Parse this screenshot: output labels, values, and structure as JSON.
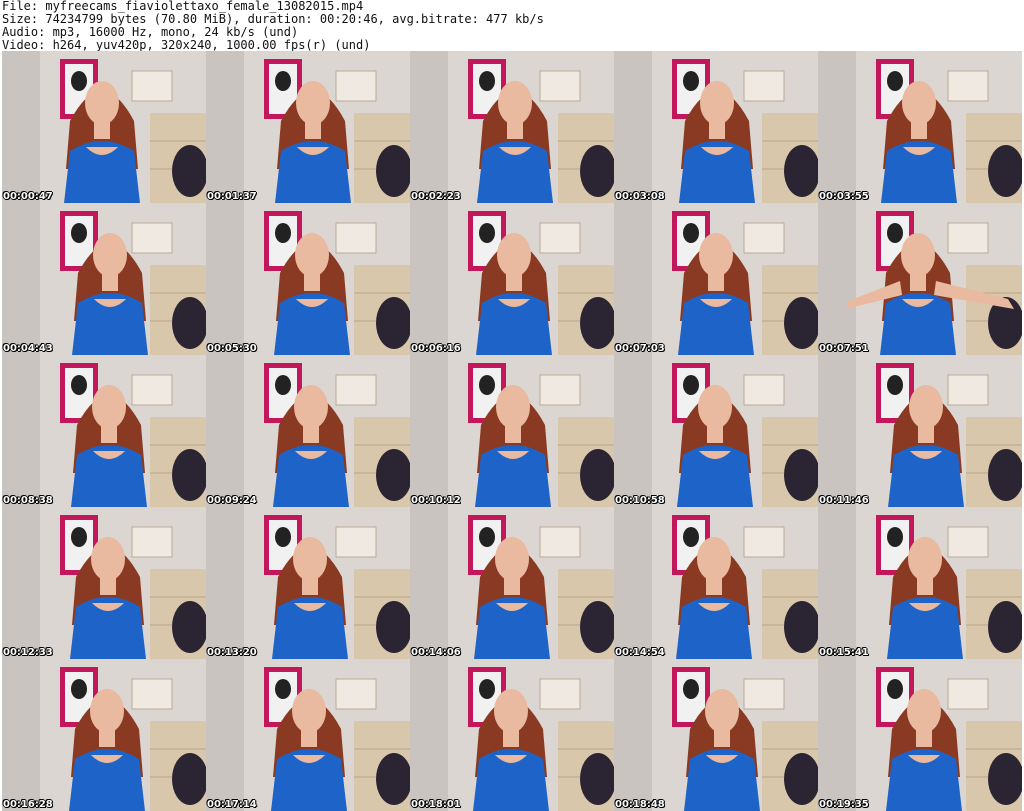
{
  "header": {
    "file_line": "File: myfreecams_fiaviolettaxo_female_13082015.mp4",
    "size_line": "Size: 74234799 bytes (70.80 MiB), duration: 00:20:46, avg.bitrate: 477 kb/s",
    "audio_line": "Audio: mp3, 16000 Hz, mono, 24 kb/s (und)",
    "video_line": "Video: h264, yuv420p, 320x240, 1000.00 fps(r) (und)"
  },
  "thumbnails": [
    {
      "timestamp": "00:00:47"
    },
    {
      "timestamp": "00:01:37"
    },
    {
      "timestamp": "00:02:23"
    },
    {
      "timestamp": "00:03:08"
    },
    {
      "timestamp": "00:03:55"
    },
    {
      "timestamp": "00:04:43"
    },
    {
      "timestamp": "00:05:30"
    },
    {
      "timestamp": "00:06:16"
    },
    {
      "timestamp": "00:07:03"
    },
    {
      "timestamp": "00:07:51"
    },
    {
      "timestamp": "00:08:38"
    },
    {
      "timestamp": "00:09:24"
    },
    {
      "timestamp": "00:10:12"
    },
    {
      "timestamp": "00:10:58"
    },
    {
      "timestamp": "00:11:46"
    },
    {
      "timestamp": "00:12:33"
    },
    {
      "timestamp": "00:13:20"
    },
    {
      "timestamp": "00:14:06"
    },
    {
      "timestamp": "00:14:54"
    },
    {
      "timestamp": "00:15:41"
    },
    {
      "timestamp": "00:16:28"
    },
    {
      "timestamp": "00:17:14"
    },
    {
      "timestamp": "00:18:01"
    },
    {
      "timestamp": "00:18:48"
    },
    {
      "timestamp": "00:19:35"
    }
  ],
  "colors": {
    "wall": "#dcd6d2",
    "poster_frame": "#c2185b",
    "dress": "#1e63c8",
    "hair": "#8a3a22",
    "skin": "#e9b9a0",
    "bag": "#2b2533",
    "dresser": "#d8c7aa"
  }
}
